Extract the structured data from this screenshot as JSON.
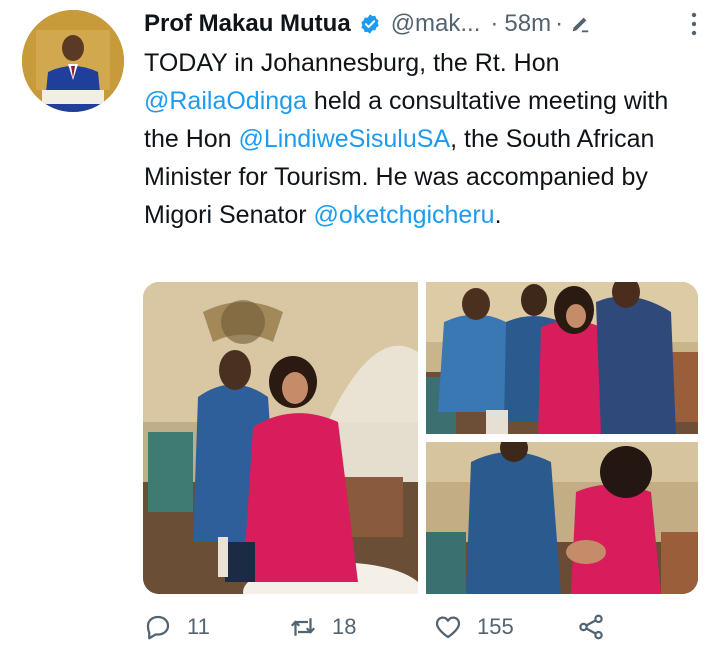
{
  "author": {
    "name": "Prof Makau Mutua",
    "handle": "@mak...",
    "separator": "·",
    "time": "58m",
    "separator2": "·"
  },
  "tweet": {
    "part1": "TODAY in Johannesburg, the Rt. Hon ",
    "mention1": "@RailaOdinga",
    "part2": " held a consultative meeting with the Hon ",
    "mention2": "@LindiweSisuluSA",
    "part3": ", the South African Minister for Tourism.  He was accompanied by Migori Senator ",
    "mention3": "@oketchgicheru",
    "part4": "."
  },
  "actions": {
    "replies": "11",
    "retweets": "18",
    "likes": "155"
  },
  "icons": [
    "verified-badge-icon",
    "edit-icon",
    "more-icon",
    "reply-icon",
    "retweet-icon",
    "like-icon",
    "share-icon"
  ],
  "colors": {
    "accent": "#1d9bf0",
    "text": "#0f1419",
    "muted": "#536471"
  }
}
